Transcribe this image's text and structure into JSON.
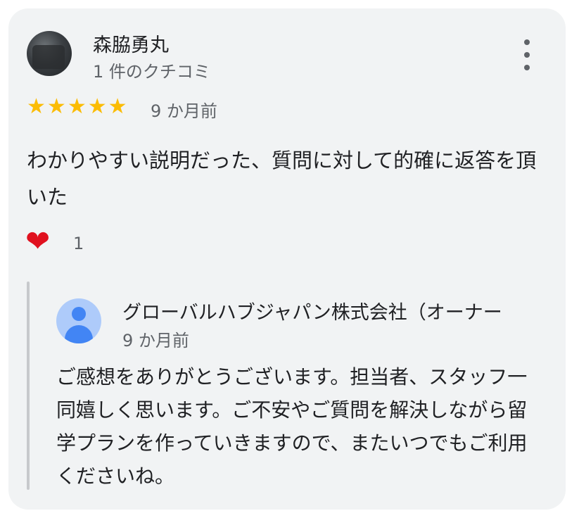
{
  "review": {
    "reviewer_name": "森脇勇丸",
    "review_count": "1 件のクチコミ",
    "rating": 5,
    "date": "9 か月前",
    "text": "わかりやすい説明だった、質問に対して的確に返答を頂いた",
    "reaction_icon": "heart-icon",
    "reaction_count": "1"
  },
  "owner_reply": {
    "name": "グローバルハブジャパン株式会社（オーナー",
    "date": "9 か月前",
    "text": "ご感想をありがとうございます。担当者、スタッフ一同嬉しく思います。ご不安やご質問を解決しながら留学プランを作っていきますので、またいつでもご利用くださいね。"
  },
  "colors": {
    "card_background": "#f1f3f4",
    "star": "#fbbc04",
    "heart": "#e0111f",
    "secondary_text": "#5f6368",
    "owner_avatar_accent": "#4285f4"
  }
}
